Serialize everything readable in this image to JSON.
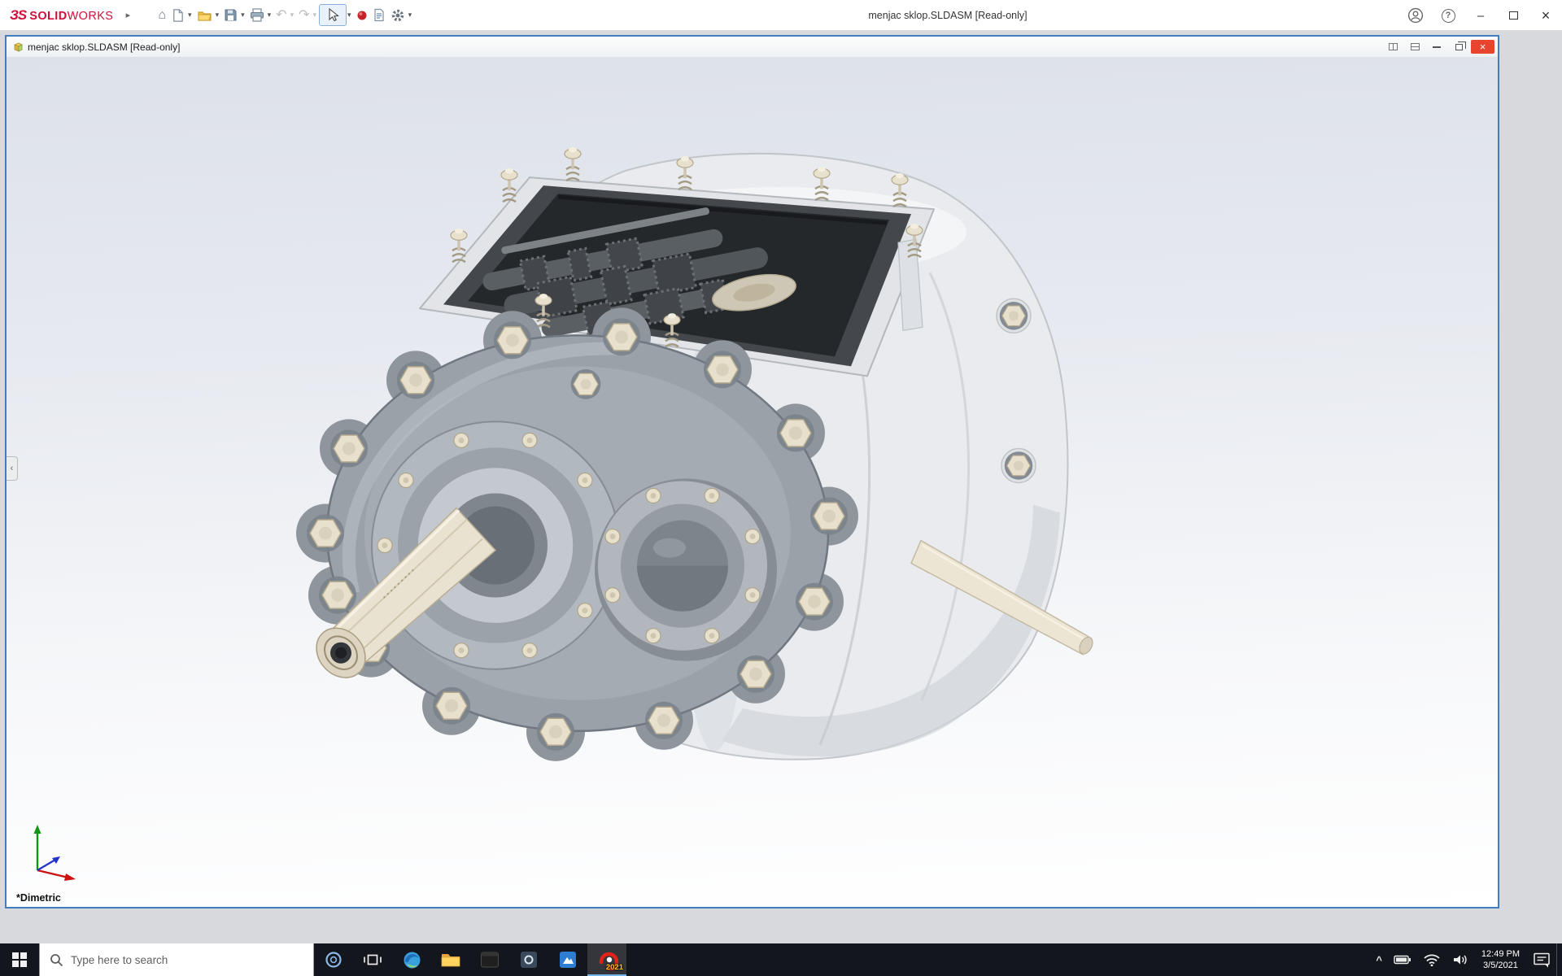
{
  "app": {
    "brand": {
      "mark": "ЗS",
      "solid": "SOLID",
      "works": "WORKS"
    },
    "title": "menjac sklop.SLDASM [Read-only]"
  },
  "glyphs": {
    "menu_expand": "▸",
    "dropdown": "▾",
    "home": "⌂",
    "undo": "↶",
    "redo": "↷",
    "help": "?",
    "minimize": "–",
    "close": "×",
    "panel_collapse": "‹",
    "tray_expand": "^"
  },
  "document": {
    "title": "menjac sklop.SLDASM [Read-only]",
    "view_label": "*Dimetric"
  },
  "taskbar": {
    "search_placeholder": "Type here to search",
    "solidworks_badge": "2021",
    "time": "12:49 PM",
    "date": "3/5/2021"
  }
}
